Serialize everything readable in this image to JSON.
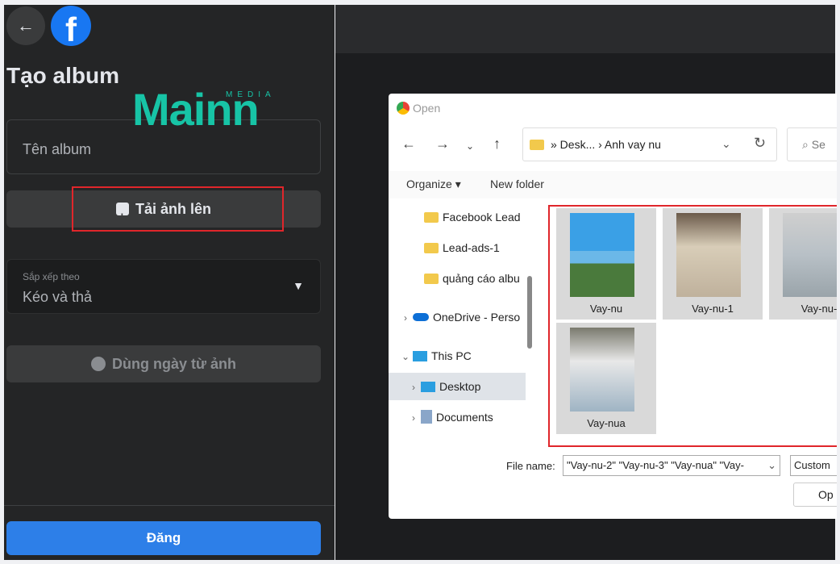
{
  "fb_panel": {
    "back_icon": "arrow-left-icon",
    "logo_letter": "f",
    "title": "Tạo album",
    "album_name_placeholder": "Tên album",
    "upload_label": "Tải ảnh lên",
    "sort": {
      "label": "Sắp xếp theo",
      "value": "Kéo và thả"
    },
    "use_date_label": "Dùng ngày từ ảnh",
    "post_label": "Đăng"
  },
  "watermark": {
    "brand": "Mainn",
    "sub": "MEDIA"
  },
  "dialog": {
    "title": "Open",
    "path": "» Desk... › Anh vay nu",
    "search_placeholder": "Se",
    "toolbar": {
      "organize": "Organize ▾",
      "new_folder": "New folder"
    },
    "tree": [
      "Facebook Lead",
      "Lead-ads-1",
      "quảng cáo albu",
      "OneDrive - Perso",
      "This PC",
      "Desktop",
      "Documents"
    ],
    "files": [
      "Vay-nu",
      "Vay-nu-1",
      "Vay-nu-",
      "Vay-nua"
    ],
    "file_name_label": "File name:",
    "file_name_value": "\"Vay-nu-2\" \"Vay-nu-3\" \"Vay-nua\" \"Vay-",
    "file_type": "Custom",
    "open_label": "Op"
  },
  "colors": {
    "fb_blue": "#1877f2",
    "highlight_red": "#e0262b",
    "watermark": "#17c4a6"
  }
}
